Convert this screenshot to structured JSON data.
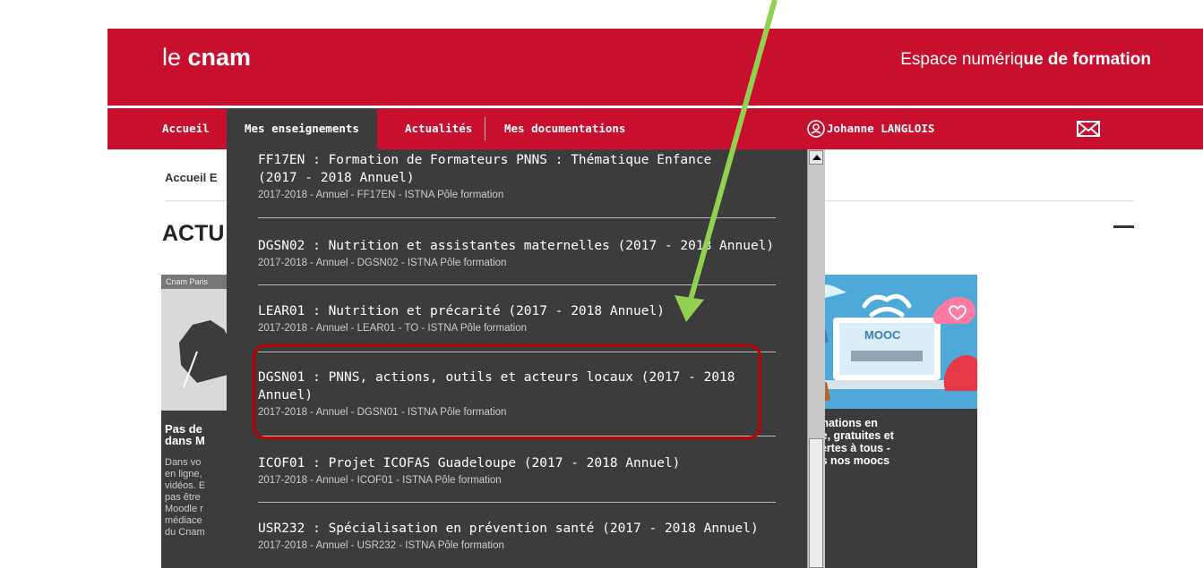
{
  "header": {
    "logo_le": "le ",
    "logo_cnam": "cnam",
    "tagline_part1": "Espace numériq",
    "tagline_part2": "ue de formation"
  },
  "nav": {
    "items": [
      "Accueil",
      "Mes enseignements",
      "Actualités",
      "Mes documentations"
    ],
    "user": "Johanne LANGLOIS"
  },
  "page": {
    "breadcrumb": "Accueil E",
    "section_title": "ACTU",
    "card_left": {
      "tag": "Cnam Paris",
      "title": "Pas de\ndans M",
      "desc": "Dans vo\nen ligne,\nvidéos. E\npas être\nMoodle r\nmédiace\ndu Cnam"
    },
    "card_right": {
      "title": "rmations en\nne, gratuites et\nvertes à tous -\nus nos moocs",
      "image_label": "MOOC"
    }
  },
  "dropdown": {
    "items": [
      {
        "title": "FF17EN : Formation de Formateurs PNNS : Thématique Enfance\n(2017 - 2018 Annuel)",
        "sub": "2017-2018 - Annuel - FF17EN - ISTNA Pôle formation"
      },
      {
        "title": "DGSN02 : Nutrition et assistantes maternelles (2017 - 2018 Annuel)",
        "sub": "2017-2018 - Annuel - DGSN02 - ISTNA Pôle formation"
      },
      {
        "title": "LEAR01 : Nutrition et précarité (2017 - 2018 Annuel)",
        "sub": "2017-2018 - Annuel - LEAR01 - TO - ISTNA Pôle formation"
      },
      {
        "title": "DGSN01 : PNNS, actions, outils et acteurs locaux (2017 - 2018\nAnnuel)",
        "sub": "2017-2018 - Annuel - DGSN01 - ISTNA Pôle formation"
      },
      {
        "title": "ICOF01 : Projet ICOFAS Guadeloupe (2017 - 2018 Annuel)",
        "sub": "2017-2018 - Annuel - ICOF01 - ISTNA Pôle formation"
      },
      {
        "title": "USR232 : Spécialisation en prévention santé (2017 - 2018 Annuel)",
        "sub": "2017-2018 - Annuel - USR232 - ISTNA Pôle formation"
      }
    ]
  },
  "colors": {
    "brand_red": "#c8102e",
    "dark_panel": "#3c3c3c",
    "highlight_red": "#c00000",
    "arrow_green": "#92d050"
  }
}
